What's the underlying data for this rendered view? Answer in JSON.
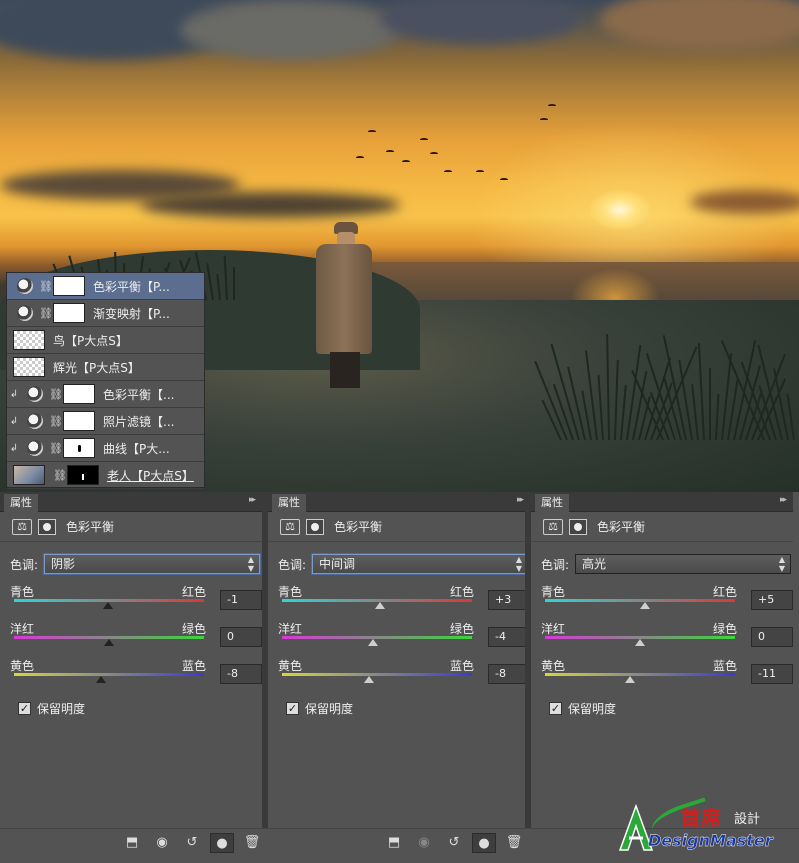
{
  "layers_panel": {
    "layers": [
      {
        "name": "色彩平衡【P...",
        "kind": "adjustment",
        "selected": true,
        "clipped": false,
        "visible": true,
        "thumb": "white"
      },
      {
        "name": "渐变映射【P...",
        "kind": "adjustment",
        "selected": false,
        "clipped": false,
        "visible": true,
        "thumb": "white"
      },
      {
        "name": "鸟【P大点S】",
        "kind": "pixel",
        "selected": false,
        "clipped": false,
        "visible": false,
        "thumb": "transparent"
      },
      {
        "name": "辉光【P大点S】",
        "kind": "pixel",
        "selected": false,
        "clipped": false,
        "visible": false,
        "thumb": "transparent"
      },
      {
        "name": "色彩平衡【...",
        "kind": "adjustment",
        "selected": false,
        "clipped": true,
        "visible": true,
        "thumb": "white"
      },
      {
        "name": "照片滤镜【...",
        "kind": "adjustment",
        "selected": false,
        "clipped": true,
        "visible": true,
        "thumb": "white"
      },
      {
        "name": "曲线【P大...",
        "kind": "adjustment",
        "selected": false,
        "clipped": true,
        "visible": true,
        "thumb": "curve"
      },
      {
        "name": "老人【P大点S】",
        "kind": "smart-object",
        "selected": false,
        "clipped": false,
        "visible": false,
        "thumb": "photo"
      }
    ]
  },
  "properties_panels": [
    {
      "tab_label": "属性",
      "title": "色彩平衡",
      "tone_label": "色调:",
      "tone_value": "阴影",
      "tone_focused": true,
      "sliders": [
        {
          "left": "青色",
          "right": "红色",
          "value": "-1",
          "fraction": 0.495
        },
        {
          "left": "洋红",
          "right": "绿色",
          "value": "0",
          "fraction": 0.5
        },
        {
          "left": "黄色",
          "right": "蓝色",
          "value": "-8",
          "fraction": 0.46
        }
      ],
      "preserve_label": "保留明度",
      "preserve_checked": true
    },
    {
      "tab_label": "属性",
      "title": "色彩平衡",
      "tone_label": "色调:",
      "tone_value": "中间调",
      "tone_focused": true,
      "sliders": [
        {
          "left": "青色",
          "right": "红色",
          "value": "+3",
          "fraction": 0.515
        },
        {
          "left": "洋红",
          "right": "绿色",
          "value": "-4",
          "fraction": 0.48
        },
        {
          "left": "黄色",
          "right": "蓝色",
          "value": "-8",
          "fraction": 0.46
        }
      ],
      "preserve_label": "保留明度",
      "preserve_checked": true
    },
    {
      "tab_label": "属性",
      "title": "色彩平衡",
      "tone_label": "色调:",
      "tone_value": "高光",
      "tone_focused": false,
      "sliders": [
        {
          "left": "青色",
          "right": "红色",
          "value": "+5",
          "fraction": 0.525
        },
        {
          "left": "洋红",
          "right": "绿色",
          "value": "0",
          "fraction": 0.5
        },
        {
          "left": "黄色",
          "right": "蓝色",
          "value": "-11",
          "fraction": 0.445
        }
      ],
      "preserve_label": "保留明度",
      "preserve_checked": true
    }
  ],
  "bottom_bar_icons": [
    "clip-to-layer-icon",
    "view-previous-icon",
    "reset-icon",
    "visibility-eye-icon",
    "trash-icon"
  ],
  "logo": {
    "cn_main": "首席",
    "cn_sub": "設計",
    "en": "DesignMaster"
  },
  "colors": {
    "panel_bg": "#535353",
    "selected_layer": "#5b6e8f",
    "logo_red": "#d02020",
    "logo_blue": "#1a3aa0",
    "logo_green": "#2aa83a"
  }
}
